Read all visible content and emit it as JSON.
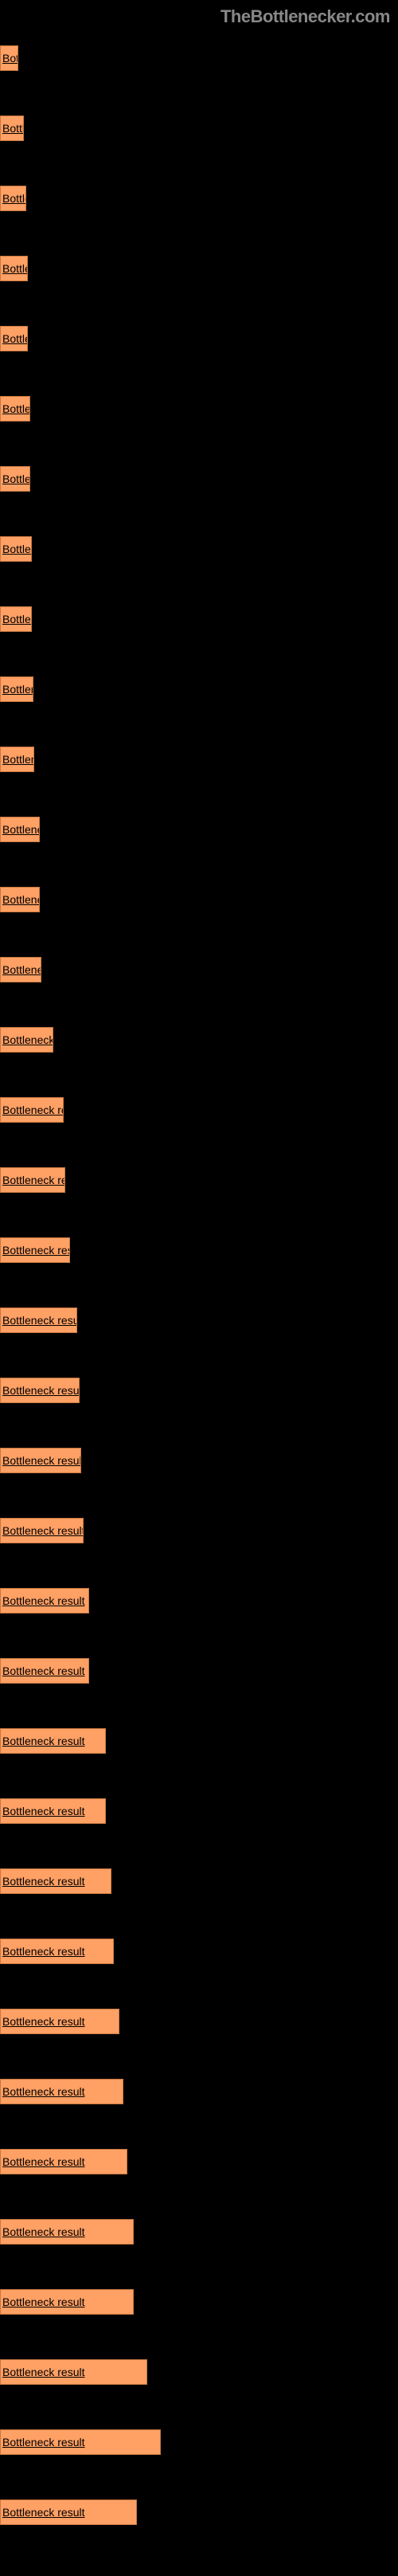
{
  "watermark": "TheBottlenecker.com",
  "chart_data": {
    "type": "bar",
    "title": "",
    "xlabel": "",
    "ylabel": "",
    "label": "Bottleneck result",
    "series": [
      {
        "label": "Bottleneck result",
        "value": 23
      },
      {
        "label": "Bottleneck result",
        "value": 30
      },
      {
        "label": "Bottleneck result",
        "value": 33
      },
      {
        "label": "Bottleneck result",
        "value": 35
      },
      {
        "label": "Bottleneck result",
        "value": 35
      },
      {
        "label": "Bottleneck result",
        "value": 38
      },
      {
        "label": "Bottleneck result",
        "value": 38
      },
      {
        "label": "Bottleneck result",
        "value": 40
      },
      {
        "label": "Bottleneck result",
        "value": 40
      },
      {
        "label": "Bottleneck result",
        "value": 42
      },
      {
        "label": "Bottleneck result",
        "value": 43
      },
      {
        "label": "Bottleneck result",
        "value": 50
      },
      {
        "label": "Bottleneck result",
        "value": 50
      },
      {
        "label": "Bottleneck result",
        "value": 52
      },
      {
        "label": "Bottleneck result",
        "value": 67
      },
      {
        "label": "Bottleneck result",
        "value": 80
      },
      {
        "label": "Bottleneck result",
        "value": 82
      },
      {
        "label": "Bottleneck result",
        "value": 88
      },
      {
        "label": "Bottleneck result",
        "value": 97
      },
      {
        "label": "Bottleneck result",
        "value": 100
      },
      {
        "label": "Bottleneck result",
        "value": 102
      },
      {
        "label": "Bottleneck result",
        "value": 105
      },
      {
        "label": "Bottleneck result",
        "value": 112
      },
      {
        "label": "Bottleneck result",
        "value": 112
      },
      {
        "label": "Bottleneck result",
        "value": 133
      },
      {
        "label": "Bottleneck result",
        "value": 133
      },
      {
        "label": "Bottleneck result",
        "value": 140
      },
      {
        "label": "Bottleneck result",
        "value": 143
      },
      {
        "label": "Bottleneck result",
        "value": 150
      },
      {
        "label": "Bottleneck result",
        "value": 155
      },
      {
        "label": "Bottleneck result",
        "value": 160
      },
      {
        "label": "Bottleneck result",
        "value": 168
      },
      {
        "label": "Bottleneck result",
        "value": 168
      },
      {
        "label": "Bottleneck result",
        "value": 185
      },
      {
        "label": "Bottleneck result",
        "value": 202
      },
      {
        "label": "Bottleneck result",
        "value": 172
      }
    ],
    "max_width": 500
  }
}
